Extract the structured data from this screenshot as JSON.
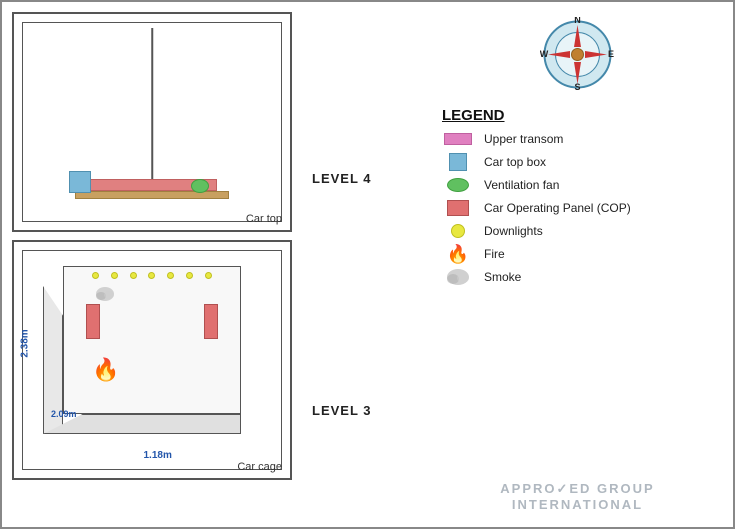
{
  "levels": {
    "level4": {
      "label": "LEVEL 4",
      "diagram_label": "Car top"
    },
    "level3": {
      "label": "LEVEL 3",
      "diagram_label": "Car cage",
      "dim1": "2.38m",
      "dim2": "2.09m",
      "dim3": "1.18m"
    }
  },
  "legend": {
    "title": "LEGEND",
    "items": [
      {
        "id": "upper-transom",
        "label": "Upper transom"
      },
      {
        "id": "car-top-box",
        "label": "Car top box"
      },
      {
        "id": "ventilation-fan",
        "label": "Ventilation fan"
      },
      {
        "id": "cop",
        "label": "Car Operating Panel (COP)"
      },
      {
        "id": "downlights",
        "label": "Downlights"
      },
      {
        "id": "fire",
        "label": "Fire"
      },
      {
        "id": "smoke",
        "label": "Smoke"
      }
    ]
  },
  "compass": {
    "directions": [
      "N",
      "S",
      "E",
      "W"
    ]
  },
  "agi": {
    "line1": "APPRO✓ED GROUP",
    "line2": "INTERNATIONAL"
  }
}
